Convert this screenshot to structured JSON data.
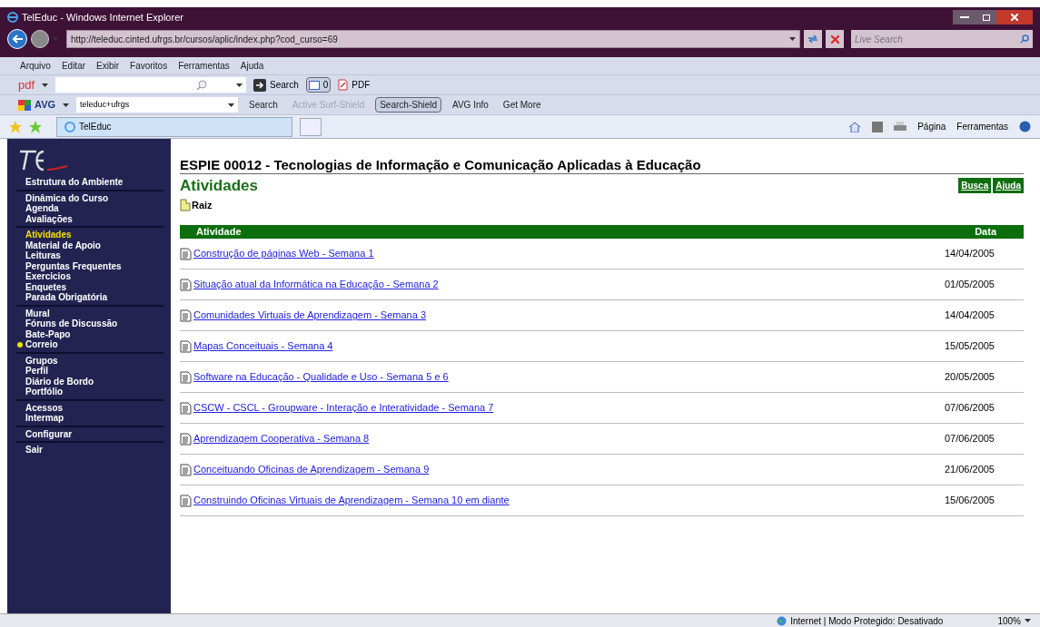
{
  "window": {
    "title": "TelEduc - Windows Internet Explorer"
  },
  "address_bar": {
    "url": "http://teleduc.cinted.ufrgs.br/cursos/aplic/index.php?cod_curso=69"
  },
  "live_search": {
    "placeholder": "Live Search"
  },
  "menu": [
    "Arquivo",
    "Editar",
    "Exibir",
    "Favoritos",
    "Ferramentas",
    "Ajuda"
  ],
  "pdf_toolbar": {
    "logo": "pdf",
    "items": [
      "Search",
      "0",
      "PDF"
    ]
  },
  "avg_toolbar": {
    "logo": "AVG",
    "query": "teleduc+ufrgs",
    "items": [
      {
        "label": "Search",
        "disabled": false
      },
      {
        "label": "Active  Surf-Shield",
        "disabled": true
      },
      {
        "label": "Search-Shield",
        "disabled": false
      },
      {
        "label": "AVG Info",
        "disabled": false
      },
      {
        "label": "Get More",
        "disabled": false
      }
    ]
  },
  "tab": {
    "label": "TelEduc"
  },
  "command_bar": [
    "Página",
    "Ferramentas"
  ],
  "sidebar": {
    "groups": [
      [
        {
          "label": "Estrutura do Ambiente",
          "selected": false,
          "new": false
        }
      ],
      [
        {
          "label": "Dinâmica do Curso",
          "selected": false,
          "new": false
        },
        {
          "label": "Agenda",
          "selected": false,
          "new": false
        },
        {
          "label": "Avaliações",
          "selected": false,
          "new": false
        }
      ],
      [
        {
          "label": "Atividades",
          "selected": true,
          "new": false
        },
        {
          "label": "Material de Apoio",
          "selected": false,
          "new": false
        },
        {
          "label": "Leituras",
          "selected": false,
          "new": false
        },
        {
          "label": "Perguntas Frequentes",
          "selected": false,
          "new": false
        },
        {
          "label": "Exercicios",
          "selected": false,
          "new": false
        },
        {
          "label": "Enquetes",
          "selected": false,
          "new": false
        },
        {
          "label": "Parada Obrigatória",
          "selected": false,
          "new": false
        }
      ],
      [
        {
          "label": "Mural",
          "selected": false,
          "new": false
        },
        {
          "label": "Fóruns de Discussão",
          "selected": false,
          "new": false
        },
        {
          "label": "Bate-Papo",
          "selected": false,
          "new": false
        },
        {
          "label": "Correio",
          "selected": false,
          "new": true
        }
      ],
      [
        {
          "label": "Grupos",
          "selected": false,
          "new": false
        },
        {
          "label": "Perfil",
          "selected": false,
          "new": false
        },
        {
          "label": "Diário de Bordo",
          "selected": false,
          "new": false
        },
        {
          "label": "Portfólio",
          "selected": false,
          "new": false
        }
      ],
      [
        {
          "label": "Acessos",
          "selected": false,
          "new": false
        },
        {
          "label": "Intermap",
          "selected": false,
          "new": false
        }
      ],
      [
        {
          "label": "Configurar",
          "selected": false,
          "new": false
        }
      ],
      [
        {
          "label": "Sair",
          "selected": false,
          "new": false
        }
      ]
    ]
  },
  "page": {
    "course_title": "ESPIE 00012 - Tecnologias de Informação e Comunicação Aplicadas à Educação",
    "heading": "Atividades",
    "buttons": [
      "Busca",
      "Ajuda"
    ],
    "folder": "Raiz"
  },
  "table": {
    "columns": [
      "Atividade",
      "Data"
    ],
    "rows": [
      {
        "title": "Construção de páginas Web - Semana 1",
        "date": "14/04/2005"
      },
      {
        "title": "Situação atual da Informática na Educação - Semana 2",
        "date": "01/05/2005"
      },
      {
        "title": "Comunidades Virtuais de Aprendizagem - Semana 3",
        "date": "14/04/2005"
      },
      {
        "title": "Mapas Conceituais - Semana 4",
        "date": "15/05/2005"
      },
      {
        "title": "Software na Educação - Qualidade e Uso - Semana 5 e 6",
        "date": "20/05/2005"
      },
      {
        "title": "CSCW - CSCL - Groupware - Interação e Interatividade - Semana 7",
        "date": "07/06/2005"
      },
      {
        "title": "Aprendizagem Cooperativa - Semana 8",
        "date": "07/06/2005"
      },
      {
        "title": "Conceituando Oficinas de Aprendizagem - Semana 9",
        "date": "21/06/2005"
      },
      {
        "title": "Construindo Oficinas Virtuais de Aprendizagem - Semana 10 em diante",
        "date": "15/06/2005"
      }
    ]
  },
  "status_bar": {
    "zone": "Internet | Modo Protegido: Desativado",
    "zoom": "100%"
  }
}
